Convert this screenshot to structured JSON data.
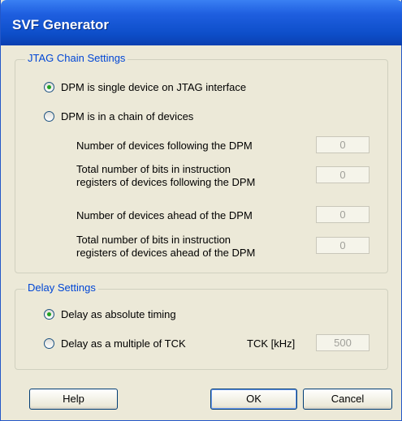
{
  "window": {
    "title": "SVF Generator"
  },
  "jtag": {
    "legend": "JTAG Chain Settings",
    "option_single": "DPM is single device on JTAG interface",
    "option_chain": "DPM is in a chain of devices",
    "selected": "single",
    "devices_following_label": "Number of devices following  the DPM",
    "devices_following_value": "0",
    "bits_following_label_1": "Total number of bits in instruction",
    "bits_following_label_2": "registers of devices following the DPM",
    "bits_following_value": "0",
    "devices_ahead_label": "Number of devices ahead of the DPM",
    "devices_ahead_value": "0",
    "bits_ahead_label_1": "Total number of bits in instruction",
    "bits_ahead_label_2": "registers of devices ahead of the DPM",
    "bits_ahead_value": "0"
  },
  "delay": {
    "legend": "Delay Settings",
    "option_absolute": "Delay as absolute timing",
    "option_multiple": "Delay as a multiple of TCK",
    "selected": "absolute",
    "tck_label": "TCK [kHz]",
    "tck_value": "500"
  },
  "buttons": {
    "help": "Help",
    "ok": "OK",
    "cancel": "Cancel"
  },
  "colors": {
    "title_bar": "#0d4ec9",
    "group_legend": "#0046d5",
    "radio_selected": "#21a121",
    "dialog_bg": "#ece9d8"
  }
}
